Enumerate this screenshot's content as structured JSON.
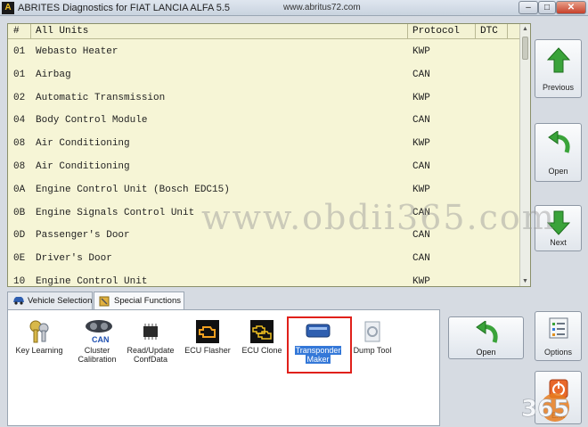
{
  "window": {
    "app_icon": "A",
    "title": "ABRITES Diagnostics for FIAT LANCIA ALFA 5.5",
    "url": "www.abritus72.com",
    "controls": [
      "minimize-icon",
      "maximize-icon",
      "close-icon"
    ]
  },
  "units_table": {
    "headers": {
      "num": "#",
      "name": "All Units",
      "protocol": "Protocol",
      "dtc": "DTC"
    },
    "rows": [
      {
        "num": "01",
        "name": "Webasto Heater",
        "protocol": "KWP"
      },
      {
        "num": "01",
        "name": "Airbag",
        "protocol": "CAN"
      },
      {
        "num": "02",
        "name": "Automatic Transmission",
        "protocol": "KWP"
      },
      {
        "num": "04",
        "name": "Body Control Module",
        "protocol": "CAN"
      },
      {
        "num": "08",
        "name": "Air Conditioning",
        "protocol": "KWP"
      },
      {
        "num": "08",
        "name": "Air Conditioning",
        "protocol": "CAN"
      },
      {
        "num": "0A",
        "name": "Engine Control Unit (Bosch EDC15)",
        "protocol": "KWP"
      },
      {
        "num": "0B",
        "name": "Engine Signals Control Unit",
        "protocol": "CAN"
      },
      {
        "num": "0D",
        "name": "Passenger's Door",
        "protocol": "CAN"
      },
      {
        "num": "0E",
        "name": "Driver's Door",
        "protocol": "CAN"
      },
      {
        "num": "10",
        "name": "Engine Control Unit",
        "protocol": "KWP"
      }
    ]
  },
  "nav": {
    "previous": "Previous",
    "open": "Open",
    "next": "Next",
    "options": "Options",
    "exit": "Exit"
  },
  "tabs": [
    {
      "label": "Vehicle Selection",
      "icon": "car-icon"
    },
    {
      "label": "Special Functions",
      "icon": "tools-icon"
    }
  ],
  "functions": [
    {
      "line1": "Key Learning",
      "line2": "",
      "icon": "keys-icon"
    },
    {
      "line1": "Cluster",
      "line2": "Calibration",
      "icon": "can-cluster-icon"
    },
    {
      "line1": "Read/Update",
      "line2": "ConfData",
      "icon": "chip-icon"
    },
    {
      "line1": "ECU Flasher",
      "line2": "",
      "icon": "engine-warning-icon"
    },
    {
      "line1": "ECU Clone",
      "line2": "",
      "icon": "engine-clone-icon"
    },
    {
      "line1": "Transponder",
      "line2": "Maker",
      "icon": "transponder-icon"
    },
    {
      "line1": "Dump Tool",
      "line2": "",
      "icon": "dump-tool-icon"
    }
  ],
  "open_button": "Open",
  "watermark": "www.obdii365.com",
  "badge": "365",
  "colors": {
    "table_bg": "#f6f5d6",
    "nav_arrow": "#3aa33a",
    "highlight": "#e0201a",
    "selection": "#3478d8"
  }
}
